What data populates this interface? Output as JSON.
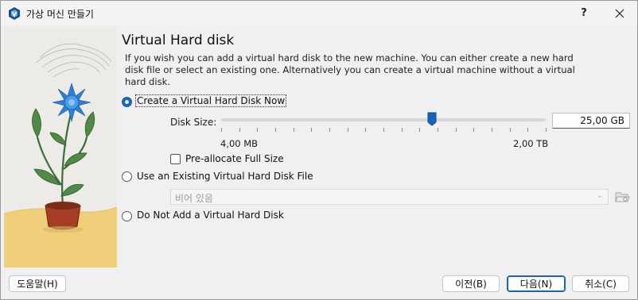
{
  "window": {
    "title": "가상 머신 만들기",
    "help": "?",
    "close_icon": "close-icon"
  },
  "page": {
    "heading": "Virtual Hard disk",
    "description": "If you wish you can add a virtual hard disk to the new machine. You can either create a new hard disk file or select an existing one. Alternatively you can create a virtual machine without a virtual hard disk."
  },
  "options": {
    "create": {
      "label": "Create a Virtual Hard Disk Now",
      "checked": true
    },
    "existing": {
      "label": "Use an Existing Virtual Hard Disk File",
      "checked": false
    },
    "none": {
      "label": "Do Not Add a Virtual Hard Disk",
      "checked": false
    }
  },
  "disk": {
    "size_label": "Disk Size:",
    "size_value": "25,00 GB",
    "min_label": "4,00 MB",
    "max_label": "2,00 TB",
    "slider_fraction": 0.65,
    "prealloc_label": "Pre-allocate Full Size",
    "prealloc_checked": false
  },
  "existing_file": {
    "combo_value": "비어 있음",
    "folder_icon": "folder-open-icon"
  },
  "buttons": {
    "help": "도움말(H)",
    "back": "이전(B)",
    "next": "다음(N)",
    "cancel": "취소(C)"
  },
  "colors": {
    "accent": "#1565c0",
    "background": "#f0f0f0",
    "flower": "#2f7fd6"
  }
}
